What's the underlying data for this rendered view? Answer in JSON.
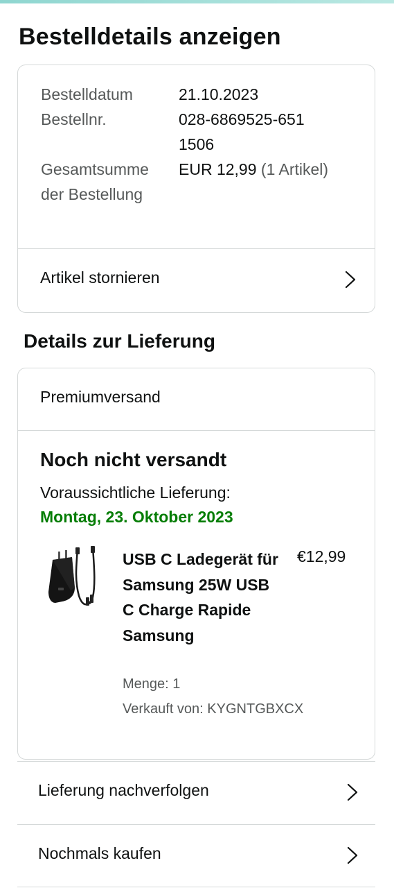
{
  "header": {
    "title": "Bestelldetails anzeigen"
  },
  "order_summary": {
    "date_label": "Bestelldatum",
    "date_value": "21.10.2023",
    "number_label": "Bestellnr.",
    "number_value": "028-6869525-6511506",
    "total_label": "Gesamtsumme der Bestellung",
    "total_value": "EUR 12,99",
    "total_items": "(1 Artikel)",
    "cancel_label": "Artikel stornieren"
  },
  "delivery": {
    "section_title": "Details zur Lieferung",
    "shipping_type": "Premiumversand",
    "status": "Noch nicht versandt",
    "eta_label": "Voraussichtliche Lieferung:",
    "eta_date": "Montag, 23. Oktober 2023",
    "accent_color": "#067d06"
  },
  "product": {
    "title": "USB C Ladegerät für Samsung 25W USB C Charge Rapide Samsung",
    "price": "€12,99",
    "quantity": "Menge: 1",
    "seller": "Verkauft von: KYGNTGBXCX",
    "image": "black-usb-c-charger-with-cable"
  },
  "actions": {
    "track_label": "Lieferung nachverfolgen",
    "rebuy_label": "Nochmals kaufen"
  },
  "icons": {
    "chevron": "chevron-right-icon"
  }
}
